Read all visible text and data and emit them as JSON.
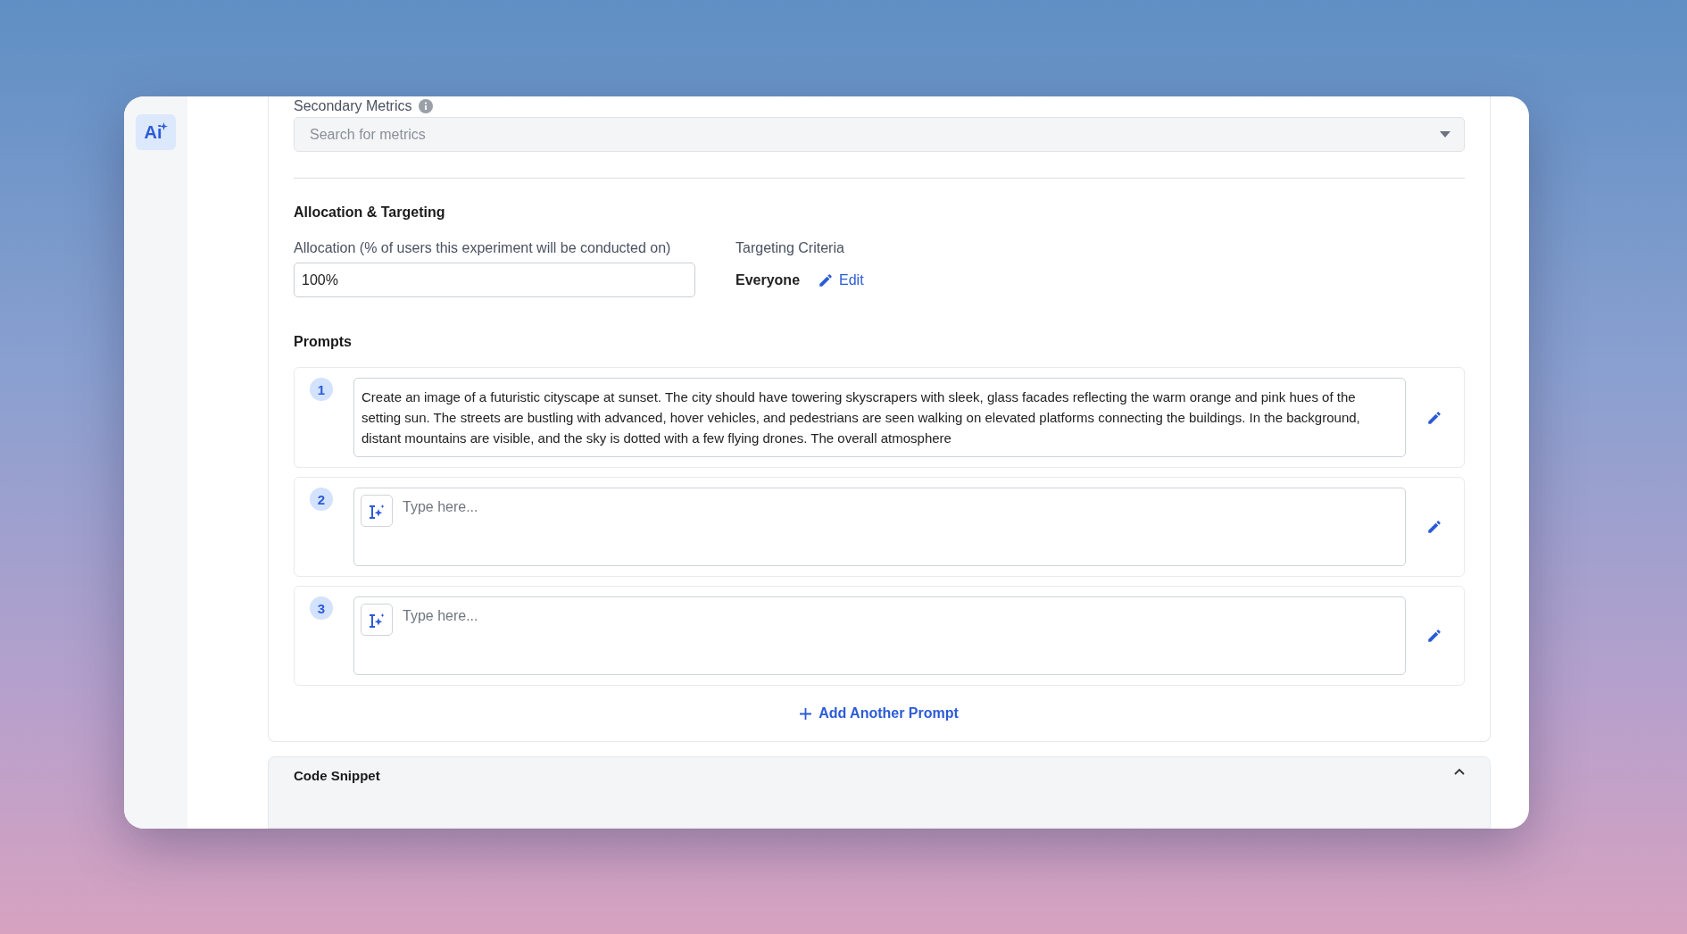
{
  "sidebar": {
    "logo": "Ai"
  },
  "secondary_metrics": {
    "label": "Secondary Metrics",
    "search": {
      "placeholder": "Search for metrics"
    }
  },
  "allocation_targeting": {
    "title": "Allocation & Targeting",
    "allocation": {
      "label": "Allocation (% of users this experiment will be conducted on)",
      "value": "100%"
    },
    "targeting": {
      "label": "Targeting Criteria",
      "value": "Everyone",
      "edit_link": "Edit"
    }
  },
  "prompts": {
    "title": "Prompts",
    "items": [
      {
        "number": "1",
        "value": "Create an image of a futuristic cityscape at sunset. The city should have towering skyscrapers with sleek, glass facades reflecting the warm orange and pink hues of the setting sun. The streets are bustling with advanced, hover vehicles, and pedestrians are seen walking on elevated platforms connecting the buildings. In the background, distant mountains are visible, and the sky is dotted with a few flying drones. The overall atmosphere"
      },
      {
        "number": "2",
        "placeholder": "Type here..."
      },
      {
        "number": "3",
        "placeholder": "Type here..."
      }
    ],
    "add_button": "Add Another Prompt"
  },
  "code_snippet": {
    "title": "Code Snippet",
    "expanded": true
  }
}
